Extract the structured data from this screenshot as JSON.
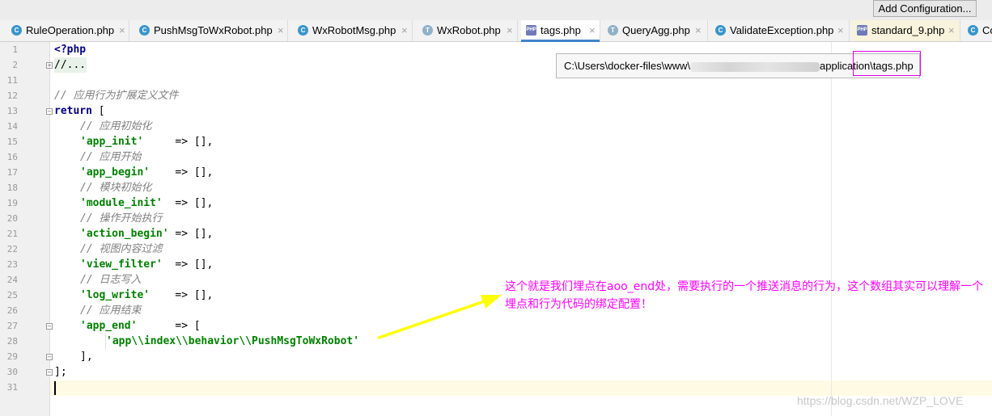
{
  "toolbar": {
    "config_label": "Add Configuration..."
  },
  "tabs": [
    {
      "label": "RuleOperation.php",
      "icon": "class-c-icon"
    },
    {
      "label": "PushMsgToWxRobot.php",
      "icon": "class-c-icon"
    },
    {
      "label": "WxRobotMsg.php",
      "icon": "class-c-icon"
    },
    {
      "label": "WxRobot.php",
      "icon": "trait-t-icon"
    },
    {
      "label": "tags.php",
      "icon": "php-file-icon",
      "active": true
    },
    {
      "label": "QueryAgg.php",
      "icon": "trait-t-icon"
    },
    {
      "label": "ValidateException.php",
      "icon": "class-c-icon"
    },
    {
      "label": "standard_9.php",
      "icon": "php-file-icon"
    },
    {
      "label": "Co",
      "icon": "class-c-icon"
    }
  ],
  "close_glyph": "×",
  "line_numbers": [
    "1",
    "2",
    "11",
    "12",
    "13",
    "14",
    "15",
    "16",
    "17",
    "18",
    "19",
    "20",
    "21",
    "22",
    "23",
    "24",
    "25",
    "26",
    "27",
    "28",
    "29",
    "30",
    "31"
  ],
  "code": {
    "l1": "<?php",
    "l2": "//...",
    "l12": "// 应用行为扩展定义文件",
    "l13_kw": "return",
    "l13_rest": " [",
    "l14": "// 应用初始化",
    "l15_key": "'app_init'",
    "l15_rest": "     => [],",
    "l16": "// 应用开始",
    "l17_key": "'app_begin'",
    "l17_rest": "    => [],",
    "l18": "// 模块初始化",
    "l19_key": "'module_init'",
    "l19_rest": "  => [],",
    "l20": "// 操作开始执行",
    "l21_key": "'action_begin'",
    "l21_rest": " => [],",
    "l22": "// 视图内容过滤",
    "l23_key": "'view_filter'",
    "l23_rest": "  => [],",
    "l24": "// 日志写入",
    "l25_key": "'log_write'",
    "l25_rest": "    => [],",
    "l26": "// 应用结束",
    "l27_key": "'app_end'",
    "l27_rest": "      => [",
    "l28": "'app\\\\index\\\\behavior\\\\PushMsgToWxRobot'",
    "l29": "],",
    "l30": "];"
  },
  "tooltip": {
    "prefix": "C:\\Users\\docker-files\\www\\",
    "middle": "application\\",
    "file": "tags.php"
  },
  "annotation": {
    "text": "这个就是我们埋点在aoo_end处，需要执行的一个推送消息的行为，这个数组其实可以理解一个埋点和行为代码的绑定配置！",
    "color": "#ff00ff",
    "arrow_color": "#ffff00"
  },
  "watermark": "https://blog.csdn.net/WZP_LOVE"
}
